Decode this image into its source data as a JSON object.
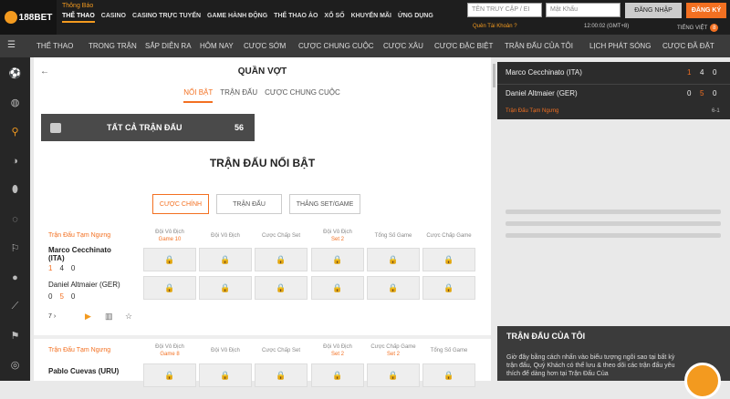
{
  "brand": {
    "logo_text": "188BET"
  },
  "header": {
    "notice": "Thông Báo",
    "nav": [
      "THỂ THAO",
      "CASINO",
      "CASINO TRỰC TUYẾN",
      "GAME HÀNH ĐỘNG",
      "THỂ THAO ẢO",
      "XỔ SỐ",
      "KHUYẾN MÃI",
      "ỨNG DỤNG"
    ],
    "username_placeholder": "TÊN TRUY CẬP / EI",
    "password_placeholder": "Mật Khẩu",
    "login_label": "ĐĂNG NHẬP",
    "register_label": "ĐĂNG KÝ",
    "forgot": "Quên Tài Khoản ?",
    "clock": "12:00:02 (GMT+8)",
    "language": "TIẾNG VIỆT",
    "lang_badge": "8"
  },
  "subnav": [
    "THỂ THAO",
    "TRONG TRẬN",
    "SẮP DIỄN RA",
    "HÔM NAY",
    "CƯỢC SỚM",
    "CƯỢC CHUNG CUỘC",
    "CƯỢC XÂU",
    "CƯỢC ĐẶC BIỆT",
    "TRẬN ĐẤU CỦA TÔI",
    "LỊCH PHÁT SÓNG",
    "CƯỢC ĐÃ ĐẶT"
  ],
  "page": {
    "title": "QUẦN VỢT",
    "tabs": [
      "NỔI BẬT",
      "TRẬN ĐẤU",
      "CƯỢC CHUNG CUỘC"
    ],
    "all_matches_label": "TẤT CẢ TRẬN ĐẤU",
    "all_matches_count": "56",
    "section_title": "TRẬN ĐẤU NỔI BẬT",
    "filters": [
      "CƯỢC CHÍNH",
      "TRẬN ĐẤU",
      "THẮNG SET/GAME"
    ]
  },
  "match1": {
    "status": "Trận Đấu Tạm Ngưng",
    "columns": [
      [
        "Đội Vô Địch",
        "Game 10"
      ],
      [
        "Đội Vô Địch",
        ""
      ],
      [
        "Cược Chấp Set",
        ""
      ],
      [
        "Đội Vô Địch",
        "Set 2"
      ],
      [
        "Tổng Số Game",
        ""
      ],
      [
        "Cược Chấp Game",
        ""
      ]
    ],
    "team1": "Marco Cecchinato (ITA)",
    "team1_score": [
      "1",
      "4",
      "0"
    ],
    "team2": "Daniel Altmaier (GER)",
    "team2_score": [
      "0",
      "5",
      "0"
    ],
    "more": "7"
  },
  "match2": {
    "status": "Trận Đấu Tạm Ngưng",
    "columns": [
      [
        "Đội Vô Địch",
        "Game 8"
      ],
      [
        "Đội Vô Địch",
        ""
      ],
      [
        "Cược Chấp Set",
        ""
      ],
      [
        "Đội Vô Địch",
        "Set 2"
      ],
      [
        "Cược Chấp Game",
        "Set 2"
      ],
      [
        "Tổng Số Game",
        ""
      ]
    ],
    "team1": "Pablo Cuevas (URU)"
  },
  "scoreboard": {
    "team1": "Marco Cecchinato (ITA)",
    "t1": [
      "1",
      "4",
      "0"
    ],
    "team2": "Daniel Altmaier (GER)",
    "t2": [
      "0",
      "5",
      "0"
    ],
    "status": "Trận Đấu Tạm Ngưng",
    "set": "6-1"
  },
  "mymatches": {
    "title": "TRẬN ĐẤU CỦA TÔI",
    "body": "Giờ đây bằng cách nhấn vào biểu tượng ngôi sao tại bất kỳ trận đấu, Quý Khách có thể lưu & theo dõi các trận đấu yêu thích để dàng hơn tại Trận Đấu Của"
  }
}
